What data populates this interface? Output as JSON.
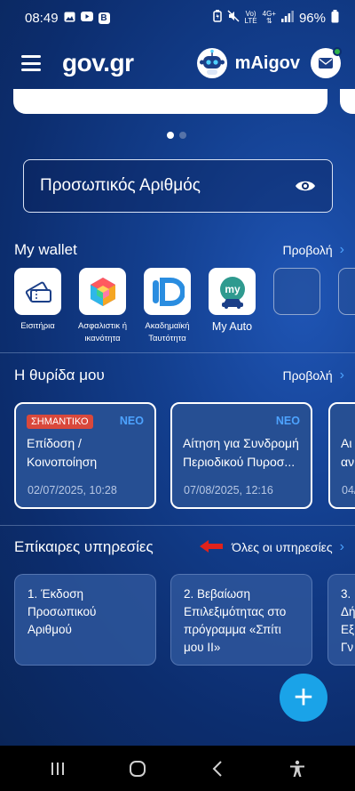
{
  "status_bar": {
    "time": "08:49",
    "battery": "96%",
    "network": "4G+",
    "volte_top": "Vo)",
    "volte_bottom": "LTE",
    "notif_badge": "B"
  },
  "header": {
    "logo_text": "gov",
    "logo_dot": ".",
    "logo_tld": "gr",
    "assistant_label": "mAigov"
  },
  "personal_number": {
    "label": "Προσωπικός Αριθμός"
  },
  "wallet": {
    "title": "My wallet",
    "view_link": "Προβολή",
    "items": [
      {
        "label": "Εισιτήρια"
      },
      {
        "label": "Ασφαλιστικ ή ικανότητα"
      },
      {
        "label": "Ακαδημαϊκή Ταυτότητα"
      },
      {
        "label": "My Auto",
        "tile_text": "my"
      }
    ]
  },
  "inbox": {
    "title": "Η θυρίδα μου",
    "view_link": "Προβολή",
    "cards": [
      {
        "badge": "ΣΗΜΑΝΤΙΚΟ",
        "new_label": "ΝΕΟ",
        "title": "Επίδοση / Κοινοποίηση",
        "date": "02/07/2025, 10:28"
      },
      {
        "new_label": "ΝΕΟ",
        "title": "Αίτηση για Συνδρομή Περιοδικού Πυροσ...",
        "date": "07/08/2025, 12:16"
      },
      {
        "title": "Αι αν",
        "date": "04/"
      }
    ]
  },
  "services": {
    "title": "Επίκαιρες υπηρεσίες",
    "all_link": "Όλες οι υπηρεσίες",
    "cards": [
      {
        "title": "1. Έκδοση Προσωπικού Αριθμού"
      },
      {
        "title": "2. Βεβαίωση Επιλεξιμότητας στο πρόγραμμα «Σπίτι μου ΙΙ»"
      },
      {
        "title": "3. Δή Εξ Γν"
      }
    ]
  },
  "fab": {
    "label": "+"
  },
  "colors": {
    "accent_blue": "#4da3ff",
    "fab": "#1aa3e8",
    "important_badge": "#d9483b",
    "online_dot": "#2fb34a"
  }
}
